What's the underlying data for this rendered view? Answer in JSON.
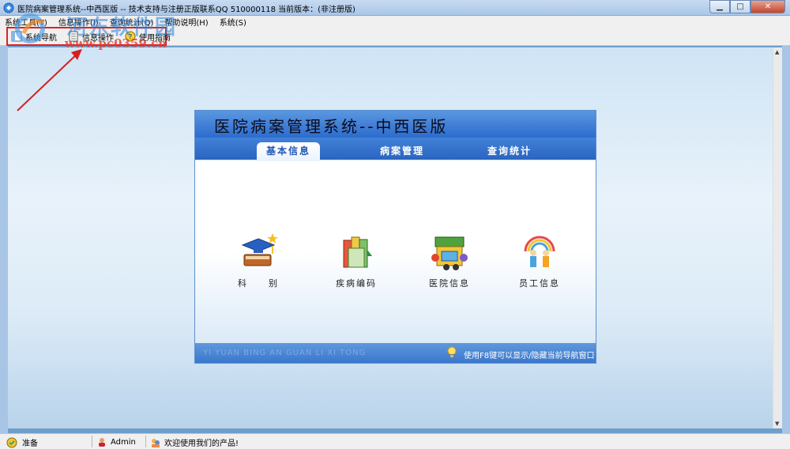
{
  "window": {
    "title": "医院病案管理系统--中西医版 -- 技术支持与注册正版联系QQ 510000118   当前版本：(非注册版)",
    "min_glyph": "▁",
    "max_glyph": "□",
    "close_glyph": "✕"
  },
  "menu": {
    "items": [
      "系统工具(T)",
      "信息操作(I)",
      "查询统计(Q)",
      "帮助说明(H)",
      "系统(S)"
    ]
  },
  "toolbar": {
    "nav_label": "系统导航",
    "info_label": "信息操作",
    "guide_label": "使用指南"
  },
  "watermark": {
    "line1": "河东软件园",
    "line2": "www.pc0359.cn"
  },
  "panel": {
    "title": "医院病案管理系统--中西医版",
    "tabs": [
      {
        "label": "基本信息",
        "active": true
      },
      {
        "label": "病案管理",
        "active": false
      },
      {
        "label": "查询统计",
        "active": false
      }
    ],
    "nav_items": [
      {
        "label": "科　　别",
        "icon": "graduation-book-icon"
      },
      {
        "label": "疾病编码",
        "icon": "books-icon"
      },
      {
        "label": "医院信息",
        "icon": "shop-icon"
      },
      {
        "label": "员工信息",
        "icon": "people-icon"
      }
    ],
    "footer_pinyin": "YI YUAN BING AN GUAN LI XI TONG",
    "footer_hint": "使用F8键可以显示/隐藏当前导航窗口"
  },
  "status": {
    "state": "准备",
    "user": "Admin",
    "message": "欢迎使用我们的产品!"
  },
  "colors": {
    "accent": "#2c6ccd",
    "highlight_box": "#e02020"
  }
}
